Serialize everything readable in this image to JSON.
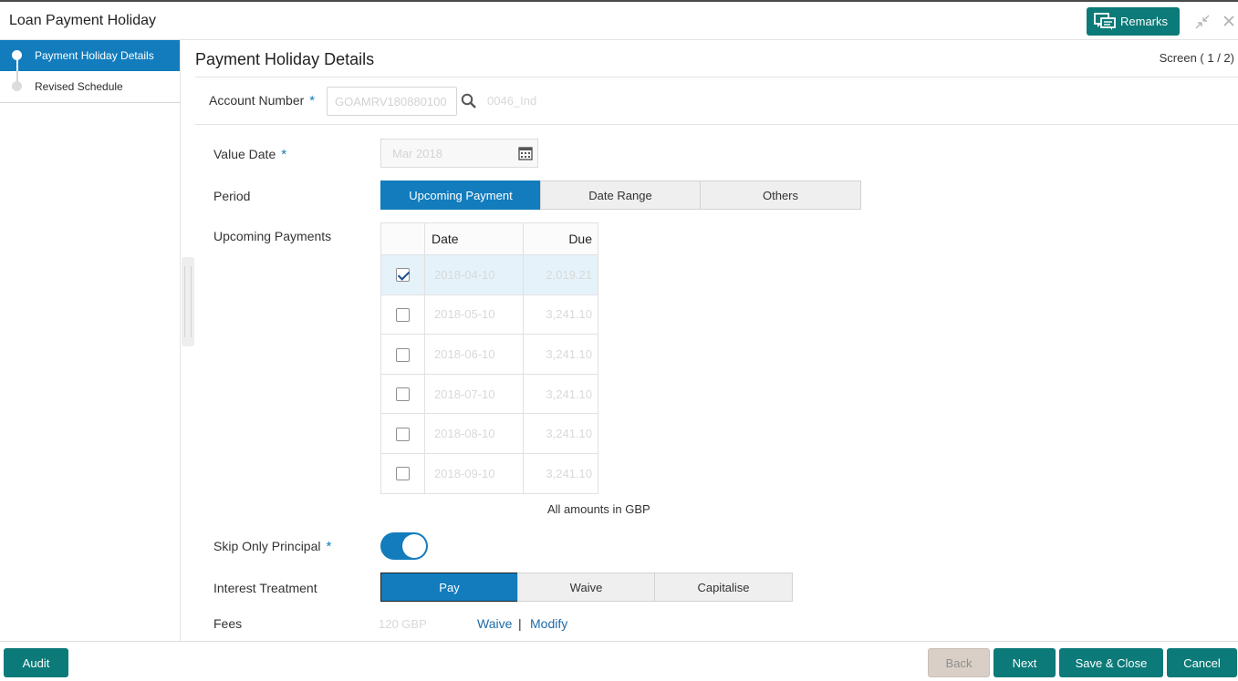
{
  "app": {
    "title": "Loan Payment Holiday",
    "remarks_label": "Remarks"
  },
  "sidebar": {
    "items": [
      {
        "label": "Payment Holiday Details",
        "active": true
      },
      {
        "label": "Revised Schedule",
        "active": false
      }
    ]
  },
  "main": {
    "title": "Payment Holiday Details",
    "screen_indicator": "Screen ( 1 / 2)",
    "account": {
      "label": "Account Number",
      "required": "*",
      "value": "GOAMRV180880100",
      "name": "0046_Ind"
    },
    "value_date": {
      "label": "Value Date",
      "required": "*",
      "value": "Mar 2018"
    },
    "period": {
      "label": "Period",
      "options": [
        "Upcoming Payment",
        "Date Range",
        "Others"
      ],
      "selected": "Upcoming Payment"
    },
    "upcoming": {
      "label": "Upcoming Payments",
      "columns": [
        "Date",
        "Due"
      ],
      "rows": [
        {
          "date": "2018-04-10",
          "due": "2,019.21",
          "checked": true
        },
        {
          "date": "2018-05-10",
          "due": "3,241.10",
          "checked": false
        },
        {
          "date": "2018-06-10",
          "due": "3,241.10",
          "checked": false
        },
        {
          "date": "2018-07-10",
          "due": "3,241.10",
          "checked": false
        },
        {
          "date": "2018-08-10",
          "due": "3,241.10",
          "checked": false
        },
        {
          "date": "2018-09-10",
          "due": "3,241.10",
          "checked": false
        }
      ],
      "note": "All amounts in GBP"
    },
    "skip_principal": {
      "label": "Skip Only Principal",
      "required": "*",
      "on": true
    },
    "interest": {
      "label": "Interest Treatment",
      "options": [
        "Pay",
        "Waive",
        "Capitalise"
      ],
      "selected": "Pay"
    },
    "fees": {
      "label": "Fees",
      "value": "120 GBP",
      "waive": "Waive",
      "separator": "|",
      "modify": "Modify"
    }
  },
  "footer": {
    "audit": "Audit",
    "back": "Back",
    "next": "Next",
    "save_close": "Save & Close",
    "cancel": "Cancel"
  },
  "colors": {
    "primary": "#127cbd",
    "teal": "#0b7a78",
    "disabled": "#d9cfc6"
  }
}
